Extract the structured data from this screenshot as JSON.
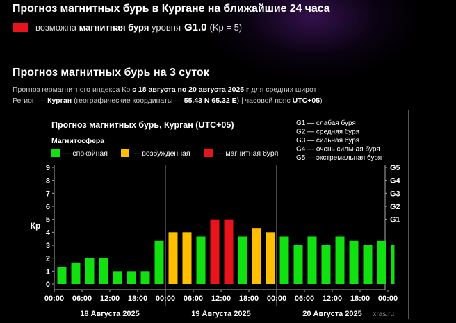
{
  "header": {
    "title": "Прогноз магнитных бурь в Кургане на ближайшие 24 часа",
    "alert_color": "#e8141c",
    "alert_prefix": "возможна",
    "alert_bold": "магнитная буря",
    "alert_mid": "уровня",
    "alert_level": "G1.0",
    "alert_kp": "(Kp = 5)"
  },
  "section": {
    "title": "Прогноз магнитных бурь на 3 суток",
    "line1_prefix": "Прогноз геомагнитного индекса Кр",
    "line1_bold": "с 18 августа по 20 августа 2025 г",
    "line1_suffix": "для средних широт",
    "line2_prefix": "Регион —",
    "line2_region": "Курган",
    "line2_mid": "(географические координаты —",
    "line2_coords": "55.43 N 65.32 E",
    "line2_tz_prefix": ") | часовой пояс",
    "line2_tz": "UTC+05",
    "line2_suffix": ")"
  },
  "chart_data": {
    "type": "bar",
    "title": "Прогноз магнитных бурь, Курган (UTC+05)",
    "legend_title": "Магнитосфера",
    "legend": [
      {
        "label": "— спокойная",
        "color": "#11e011"
      },
      {
        "label": "— возбужденная",
        "color": "#ffbf00"
      },
      {
        "label": "— магнитная буря",
        "color": "#e8141c"
      }
    ],
    "g_legend": [
      "G1 — слабая буря",
      "G2 — средняя буря",
      "G3 — сильная буря",
      "G4 — очень сильная буря",
      "G5 — экстремальная буря"
    ],
    "ylabel": "Кр",
    "ylim": [
      0,
      9
    ],
    "y_ticks": [
      "0",
      "1",
      "2",
      "3",
      "4",
      "5",
      "6",
      "7",
      "8",
      "9"
    ],
    "g_ticks": [
      {
        "label": "G1",
        "kp": 5
      },
      {
        "label": "G2",
        "kp": 6
      },
      {
        "label": "G3",
        "kp": 7
      },
      {
        "label": "G4",
        "kp": 8
      },
      {
        "label": "G5",
        "kp": 9
      }
    ],
    "x_ticks": [
      "00:00",
      "06:00",
      "12:00",
      "18:00",
      "00:00",
      "06:00",
      "12:00",
      "18:00",
      "00:00",
      "06:00",
      "12:00",
      "18:00",
      "00:00"
    ],
    "days": [
      "18 Августа 2025",
      "19 Августа 2025",
      "20 Августа 2025"
    ],
    "values": [
      1.33,
      1.67,
      2.0,
      2.0,
      1.0,
      1.0,
      1.0,
      3.33,
      4.0,
      4.0,
      3.67,
      5.0,
      5.0,
      3.67,
      4.33,
      4.0,
      3.67,
      3.0,
      3.67,
      3.0,
      3.67,
      3.33,
      3.0,
      3.33,
      3.0
    ],
    "status": [
      "quiet",
      "quiet",
      "quiet",
      "quiet",
      "quiet",
      "quiet",
      "quiet",
      "quiet",
      "active",
      "active",
      "quiet",
      "storm",
      "storm",
      "quiet",
      "active",
      "active",
      "quiet",
      "quiet",
      "quiet",
      "quiet",
      "quiet",
      "quiet",
      "quiet",
      "quiet",
      "quiet"
    ],
    "watermark": "xras.ru"
  },
  "colors": {
    "quiet": "#11e011",
    "active": "#ffbf00",
    "storm": "#e8141c"
  }
}
